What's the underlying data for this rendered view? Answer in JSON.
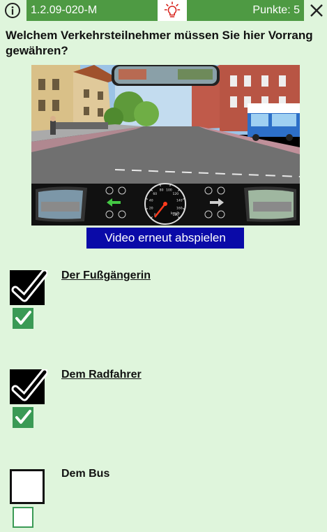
{
  "header": {
    "question_id": "1.2.09-020-M",
    "points": "Punkte: 5",
    "info_icon": "info-icon",
    "hint_icon": "lightbulb-icon",
    "close_icon": "close-icon"
  },
  "question": {
    "text": "Welchem Verkehrsteilnehmer müssen Sie hier Vorrang gewähren?"
  },
  "scene": {
    "speedometer_unit": "km/h",
    "speed_ticks": [
      "0",
      "20",
      "40",
      "60",
      "80",
      "100",
      "120",
      "140",
      "160",
      "180"
    ]
  },
  "video_button": {
    "label": "Video erneut abspielen"
  },
  "answers": [
    {
      "label": "Der Fußgängerin",
      "selected": true,
      "correct": true
    },
    {
      "label": "Dem Radfahrer",
      "selected": true,
      "correct": true
    },
    {
      "label": "Dem Bus",
      "selected": false,
      "correct": false
    }
  ],
  "colors": {
    "background": "#dff5dc",
    "header_green": "#4e9a43",
    "button_blue": "#0a0aa8",
    "check_green": "#3a9a55"
  }
}
